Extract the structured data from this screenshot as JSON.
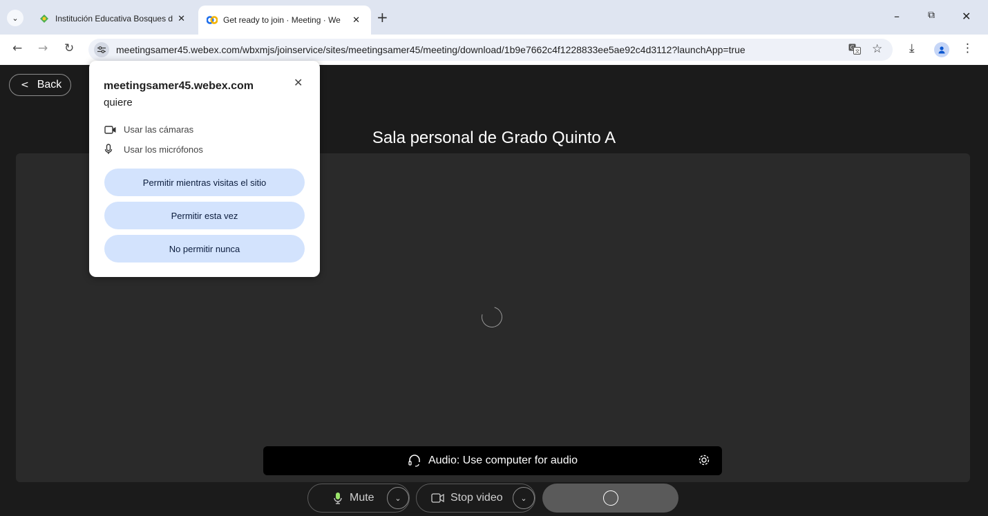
{
  "browser": {
    "tabs": [
      {
        "title": "Institución Educativa Bosques d",
        "active": false
      },
      {
        "title": "Get ready to join · Meeting · We",
        "active": true
      }
    ],
    "url": "meetingsamer45.webex.com/wbxmjs/joinservice/sites/meetingsamer45/meeting/download/1b9e7662c4f1228833ee5ae92c4d3112?launchApp=true"
  },
  "page": {
    "back_label": "Back",
    "meeting_title": "Sala personal de Grado Quinto A",
    "audio_label": "Audio: Use computer for audio",
    "mute_label": "Mute",
    "video_label": "Stop video"
  },
  "permission": {
    "site": "meetingsamer45.webex.com",
    "wants": "quiere",
    "items": [
      "Usar las cámaras",
      "Usar los micrófonos"
    ],
    "buttons": [
      "Permitir mientras visitas el sitio",
      "Permitir esta vez",
      "No permitir nunca"
    ]
  },
  "colors": {
    "page_bg": "#1b1b1b",
    "preview_bg": "#2a2a2a",
    "permission_button_bg": "#d3e3fd",
    "tabstrip_bg": "#dfe5f1"
  }
}
